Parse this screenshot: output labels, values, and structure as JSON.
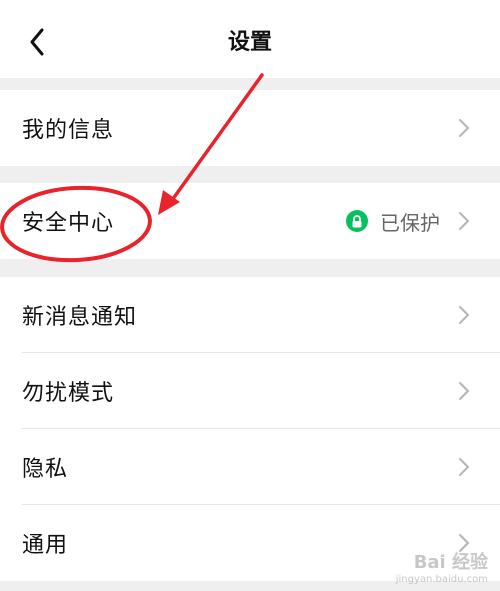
{
  "header": {
    "title": "设置",
    "back_icon": "chevron-left-icon"
  },
  "groups": [
    {
      "items": [
        {
          "label": "我的信息"
        }
      ]
    },
    {
      "items": [
        {
          "label": "安全中心",
          "status": "已保护",
          "status_icon": "lock-icon",
          "status_color": "#07c160"
        }
      ]
    },
    {
      "items": [
        {
          "label": "新消息通知"
        },
        {
          "label": "勿扰模式"
        },
        {
          "label": "隐私"
        },
        {
          "label": "通用"
        }
      ]
    }
  ],
  "annotation": {
    "color": "#e8232b",
    "shapes": [
      "ellipse-around-security-center",
      "arrow-pointing-to-security-center"
    ]
  },
  "watermark": {
    "main": "Bai 经验",
    "sub": "jingyan.baidu.com"
  }
}
